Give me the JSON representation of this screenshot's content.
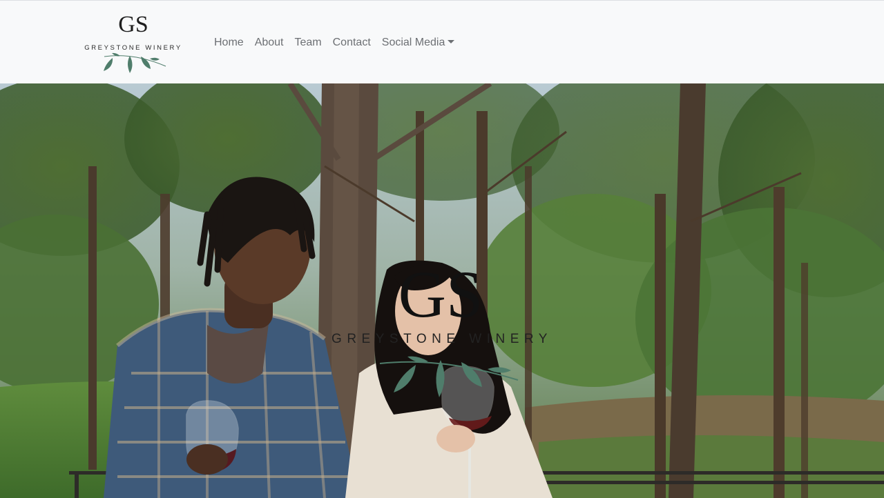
{
  "brand": {
    "monogram": "GS",
    "name": "GREYSTONE WINERY"
  },
  "nav": {
    "items": [
      {
        "label": "Home"
      },
      {
        "label": "About"
      },
      {
        "label": "Team"
      },
      {
        "label": "Contact"
      },
      {
        "label": "Social Media"
      }
    ]
  },
  "hero": {
    "logo_monogram": "GS",
    "logo_name": "GREYSTONE WINERY"
  },
  "colors": {
    "navbar_bg": "#f8f9fa",
    "nav_text": "#6c6f73",
    "leaf_green": "#4f7d6b"
  },
  "icons": {
    "dropdown": "caret-down-icon"
  }
}
